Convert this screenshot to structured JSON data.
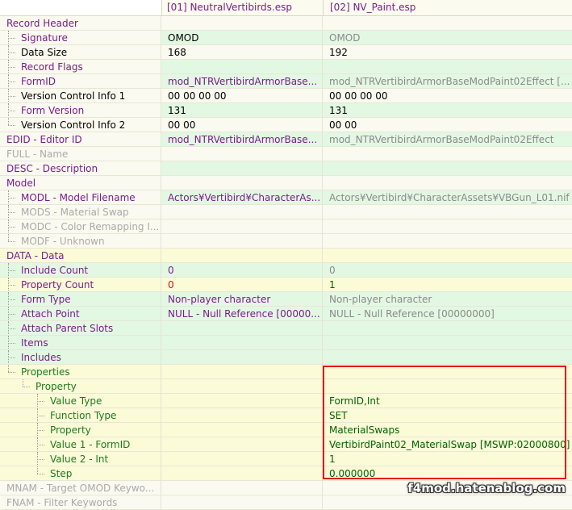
{
  "columns": [
    "[01] NeutralVertibirds.esp",
    "[02] NV_Paint.esp"
  ],
  "watermark": "f4mod.hatenablog.com",
  "rows": [
    {
      "label": "Record Header",
      "v1": "",
      "v2": "",
      "depth": 0,
      "lc": "t-pur",
      "c1": "",
      "c2": "",
      "b1": "bg-w",
      "b2": "bg-w",
      "bl": "bg-w"
    },
    {
      "label": "Signature",
      "v1": "OMOD",
      "v2": "OMOD",
      "depth": 1,
      "lc": "t-pur",
      "c1": "t-blk",
      "c2": "t-dgry",
      "b1": "bg-g",
      "b2": "bg-g",
      "bl": "bg-w"
    },
    {
      "label": "Data Size",
      "v1": "168",
      "v2": "192",
      "depth": 1,
      "lc": "t-blk",
      "c1": "t-blk",
      "c2": "t-blk",
      "b1": "bg-w",
      "b2": "bg-w",
      "bl": "bg-w"
    },
    {
      "label": "Record Flags",
      "v1": "",
      "v2": "",
      "depth": 1,
      "lc": "t-pur",
      "c1": "",
      "c2": "",
      "b1": "bg-g",
      "b2": "bg-g",
      "bl": "bg-w"
    },
    {
      "label": "FormID",
      "v1": "mod_NTRVertibirdArmorBase...",
      "v2": "mod_NTRVertibirdArmorBaseModPaint02Effect [...",
      "depth": 1,
      "lc": "t-pur",
      "c1": "t-pur",
      "c2": "t-dgry",
      "b1": "bg-g",
      "b2": "bg-g",
      "bl": "bg-w"
    },
    {
      "label": "Version Control Info 1",
      "v1": "00 00 00 00",
      "v2": "00 00 00 00",
      "depth": 1,
      "lc": "t-blk",
      "c1": "t-blk",
      "c2": "t-blk",
      "b1": "bg-w",
      "b2": "bg-w",
      "bl": "bg-w"
    },
    {
      "label": "Form Version",
      "v1": "131",
      "v2": "131",
      "depth": 1,
      "lc": "t-pur",
      "c1": "t-blk",
      "c2": "t-blk",
      "b1": "bg-g",
      "b2": "bg-g",
      "bl": "bg-w"
    },
    {
      "label": "Version Control Info 2",
      "v1": "00 00",
      "v2": "00 00",
      "depth": 1,
      "lc": "t-blk",
      "c1": "t-blk",
      "c2": "t-blk",
      "b1": "bg-w",
      "b2": "bg-w",
      "bl": "bg-w",
      "last": true
    },
    {
      "label": "EDID - Editor ID",
      "v1": "mod_NTRVertibirdArmorBase...",
      "v2": "mod_NTRVertibirdArmorBaseModPaint02Effect",
      "depth": 0,
      "lc": "t-pur",
      "c1": "t-pur",
      "c2": "t-dgry",
      "b1": "bg-g",
      "b2": "bg-g",
      "bl": "bg-w"
    },
    {
      "label": "FULL - Name",
      "v1": "",
      "v2": "",
      "depth": 0,
      "lc": "t-gry",
      "c1": "",
      "c2": "",
      "b1": "bg-w",
      "b2": "bg-w",
      "bl": "bg-w"
    },
    {
      "label": "DESC - Description",
      "v1": "",
      "v2": "",
      "depth": 0,
      "lc": "t-pur",
      "c1": "",
      "c2": "",
      "b1": "bg-g",
      "b2": "bg-g",
      "bl": "bg-w"
    },
    {
      "label": "Model",
      "v1": "",
      "v2": "",
      "depth": 0,
      "lc": "t-pur",
      "c1": "",
      "c2": "",
      "b1": "bg-w",
      "b2": "bg-w",
      "bl": "bg-w"
    },
    {
      "label": "MODL - Model Filename",
      "v1": "Actors¥Vertibird¥CharacterAs...",
      "v2": "Actors¥Vertibird¥CharacterAssets¥VBGun_L01.nif",
      "depth": 1,
      "lc": "t-pur",
      "c1": "t-pur",
      "c2": "t-dgry",
      "b1": "bg-g",
      "b2": "bg-g",
      "bl": "bg-w"
    },
    {
      "label": "MODS - Material Swap",
      "v1": "",
      "v2": "",
      "depth": 1,
      "lc": "t-gry",
      "c1": "",
      "c2": "",
      "b1": "bg-w",
      "b2": "bg-w",
      "bl": "bg-w"
    },
    {
      "label": "MODC - Color Remapping I...",
      "v1": "",
      "v2": "",
      "depth": 1,
      "lc": "t-gry",
      "c1": "",
      "c2": "",
      "b1": "bg-w",
      "b2": "bg-w",
      "bl": "bg-w"
    },
    {
      "label": "MODF - Unknown",
      "v1": "",
      "v2": "",
      "depth": 1,
      "lc": "t-gry",
      "c1": "",
      "c2": "",
      "b1": "bg-w",
      "b2": "bg-w",
      "bl": "bg-w",
      "last": true
    },
    {
      "label": "DATA - Data",
      "v1": "",
      "v2": "",
      "depth": 0,
      "lc": "t-pur",
      "c1": "",
      "c2": "",
      "b1": "bg-y",
      "b2": "bg-y",
      "bl": "bg-y"
    },
    {
      "label": "Include Count",
      "v1": "0",
      "v2": "0",
      "depth": 1,
      "lc": "t-pur",
      "c1": "t-pur",
      "c2": "t-dgry",
      "b1": "bg-g",
      "b2": "bg-g",
      "bl": "bg-g"
    },
    {
      "label": "Property Count",
      "v1": "0",
      "v2": "1",
      "depth": 1,
      "lc": "t-pur",
      "c1": "t-red",
      "c2": "t-dgrn",
      "b1": "bg-y",
      "b2": "bg-y",
      "bl": "bg-y"
    },
    {
      "label": "Form Type",
      "v1": "Non-player character",
      "v2": "Non-player character",
      "depth": 1,
      "lc": "t-pur",
      "c1": "t-pur",
      "c2": "t-dgry",
      "b1": "bg-g",
      "b2": "bg-g",
      "bl": "bg-g"
    },
    {
      "label": "Attach Point",
      "v1": "NULL - Null Reference [00000...",
      "v2": "NULL - Null Reference [00000000]",
      "depth": 1,
      "lc": "t-pur",
      "c1": "t-pur",
      "c2": "t-dgry",
      "b1": "bg-g",
      "b2": "bg-g",
      "bl": "bg-g"
    },
    {
      "label": "Attach Parent Slots",
      "v1": "",
      "v2": "",
      "depth": 1,
      "lc": "t-pur",
      "c1": "",
      "c2": "",
      "b1": "bg-g",
      "b2": "bg-g",
      "bl": "bg-g"
    },
    {
      "label": "Items",
      "v1": "",
      "v2": "",
      "depth": 1,
      "lc": "t-pur",
      "c1": "",
      "c2": "",
      "b1": "bg-g",
      "b2": "bg-g",
      "bl": "bg-g"
    },
    {
      "label": "Includes",
      "v1": "",
      "v2": "",
      "depth": 1,
      "lc": "t-pur",
      "c1": "",
      "c2": "",
      "b1": "bg-g",
      "b2": "bg-g",
      "bl": "bg-g"
    },
    {
      "label": "Properties",
      "v1": "",
      "v2": "",
      "depth": 1,
      "lc": "t-grn",
      "c1": "",
      "c2": "",
      "b1": "bg-y",
      "b2": "bg-y",
      "bl": "bg-y",
      "last": true
    },
    {
      "label": "Property",
      "v1": "",
      "v2": "",
      "depth": 2,
      "lc": "t-grn",
      "c1": "",
      "c2": "",
      "b1": "bg-y",
      "b2": "bg-y",
      "bl": "bg-y",
      "last": true
    },
    {
      "label": "Value Type",
      "v1": "",
      "v2": "FormID,Int",
      "depth": 3,
      "lc": "t-grn",
      "c1": "",
      "c2": "t-dgrn",
      "b1": "bg-y",
      "b2": "bg-y",
      "bl": "bg-y"
    },
    {
      "label": "Function Type",
      "v1": "",
      "v2": "SET",
      "depth": 3,
      "lc": "t-grn",
      "c1": "",
      "c2": "t-dgrn",
      "b1": "bg-y",
      "b2": "bg-y",
      "bl": "bg-y"
    },
    {
      "label": "Property",
      "v1": "",
      "v2": "MaterialSwaps",
      "depth": 3,
      "lc": "t-grn",
      "c1": "",
      "c2": "t-dgrn",
      "b1": "bg-y",
      "b2": "bg-y",
      "bl": "bg-y"
    },
    {
      "label": "Value 1 - FormID",
      "v1": "",
      "v2": "VertibirdPaint02_MaterialSwap [MSWP:02000800]",
      "depth": 3,
      "lc": "t-grn",
      "c1": "",
      "c2": "t-dgrn",
      "b1": "bg-y",
      "b2": "bg-y",
      "bl": "bg-y"
    },
    {
      "label": "Value 2 - Int",
      "v1": "",
      "v2": "1",
      "depth": 3,
      "lc": "t-grn",
      "c1": "",
      "c2": "t-dgrn",
      "b1": "bg-y",
      "b2": "bg-y",
      "bl": "bg-y"
    },
    {
      "label": "Step",
      "v1": "",
      "v2": "0.000000",
      "depth": 3,
      "lc": "t-grn",
      "c1": "",
      "c2": "t-dgrn",
      "b1": "bg-y",
      "b2": "bg-y",
      "bl": "bg-y",
      "last": true
    },
    {
      "label": "MNAM - Target OMOD Keywo...",
      "v1": "",
      "v2": "",
      "depth": 0,
      "lc": "t-gry",
      "c1": "",
      "c2": "",
      "b1": "bg-w",
      "b2": "bg-w",
      "bl": "bg-w"
    },
    {
      "label": "FNAM - Filter Keywords",
      "v1": "",
      "v2": "",
      "depth": 0,
      "lc": "t-gry",
      "c1": "",
      "c2": "",
      "b1": "bg-w",
      "b2": "bg-w",
      "bl": "bg-w"
    }
  ]
}
